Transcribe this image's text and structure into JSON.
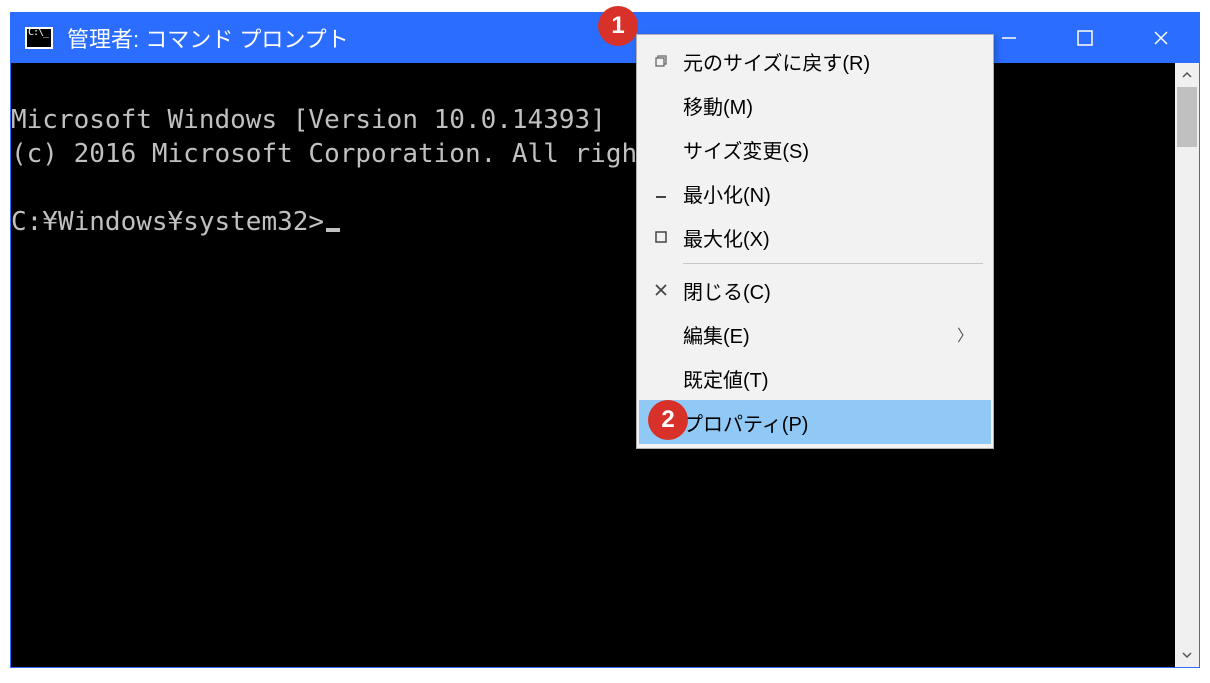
{
  "window": {
    "title": "管理者: コマンド プロンプト"
  },
  "terminal": {
    "line1": "Microsoft Windows [Version 10.0.14393]",
    "line2": "(c) 2016 Microsoft Corporation. All rights reserved.",
    "blank": "",
    "prompt": "C:¥Windows¥system32>"
  },
  "menu": {
    "restore": "元のサイズに戻す(R)",
    "move": "移動(M)",
    "size": "サイズ変更(S)",
    "minimize": "最小化(N)",
    "maximize": "最大化(X)",
    "close": "閉じる(C)",
    "edit": "編集(E)",
    "defaults": "既定値(T)",
    "properties": "プロパティ(P)"
  },
  "callouts": {
    "one": "1",
    "two": "2"
  }
}
